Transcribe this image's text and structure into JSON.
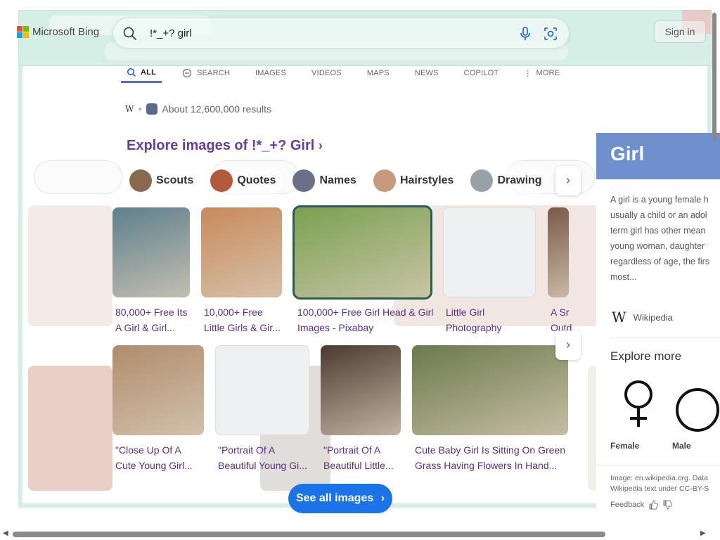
{
  "brand": {
    "name": "Microsoft Bing",
    "colors": [
      "#f25022",
      "#7fba00",
      "#00a4ef",
      "#ffb900"
    ]
  },
  "search": {
    "query": "!*_+? girl",
    "mic_icon": "microphone-icon",
    "visual_icon": "visual-search-icon",
    "search_icon": "search-icon"
  },
  "header": {
    "sign_in": "Sign in"
  },
  "scopes": [
    {
      "label": "ALL",
      "icon": "search-icon",
      "active": true
    },
    {
      "label": "SEARCH",
      "icon": "copilot-search-icon",
      "active": false
    },
    {
      "label": "IMAGES",
      "active": false
    },
    {
      "label": "VIDEOS",
      "active": false
    },
    {
      "label": "MAPS",
      "active": false
    },
    {
      "label": "NEWS",
      "active": false
    },
    {
      "label": "COPILOT",
      "active": false
    },
    {
      "label": "MORE",
      "icon": "more-vertical-icon",
      "active": false
    }
  ],
  "results": {
    "text": "About 12,600,000 results"
  },
  "explore": {
    "title": "Explore images of !*_+? Girl",
    "chips": [
      "Scouts",
      "Quotes",
      "Names",
      "Hairstyles",
      "Drawing"
    ],
    "chip_colors": [
      "#8a6a4f",
      "#b45a3c",
      "#6b6f8a",
      "#c79a7c",
      "#9aa0a8"
    ]
  },
  "images_row1": [
    {
      "caption1": "80,000+ Free Its",
      "caption2": "A Girl & Girl...",
      "color": "#5d7f8c"
    },
    {
      "caption1": "10,000+ Free",
      "caption2": "Little Girls & Gir...",
      "color": "#c98a5a"
    },
    {
      "caption1": "100,000+ Free Girl Head & Girl",
      "caption2": "Images - Pixabay",
      "color": "#7aa150"
    },
    {
      "caption1": "Little Girl",
      "caption2": "Photography",
      "color": "#eef0f2"
    },
    {
      "caption1": "A Sr",
      "caption2": "Outd",
      "color": "#7a5a48"
    }
  ],
  "images_row2": [
    {
      "caption1": "\"Close Up Of A",
      "caption2": "Cute Young Girl...",
      "color": "#b08c6c"
    },
    {
      "caption1": "\"Portrait Of A",
      "caption2": "Beautiful Young Gi...",
      "color": "#eef0f2"
    },
    {
      "caption1": "\"Portrait Of A",
      "caption2": "Beautiful Little...",
      "color": "#4c3a30"
    },
    {
      "caption1": "Cute Baby Girl Is Sitting On Green",
      "caption2": "Grass Having Flowers In Hand...",
      "color": "#6b7a4a"
    }
  ],
  "see_all": {
    "label": "See all images"
  },
  "panel": {
    "title": "Girl",
    "description": [
      "A girl is a young female h",
      "usually a child or an adol",
      "term girl has other mean",
      "young woman, daughter",
      "regardless of age, the firs",
      "most..."
    ],
    "source": "Wikipedia",
    "explore_more": "Explore more",
    "symbols": [
      {
        "label": "Female",
        "icon": "female-symbol-icon"
      },
      {
        "label": "Male",
        "icon": "male-symbol-icon"
      }
    ],
    "credit1": "Image: en.wikipedia.org. Data",
    "credit2": "Wikipedia text under CC-BY-S",
    "feedback": "Feedback"
  }
}
